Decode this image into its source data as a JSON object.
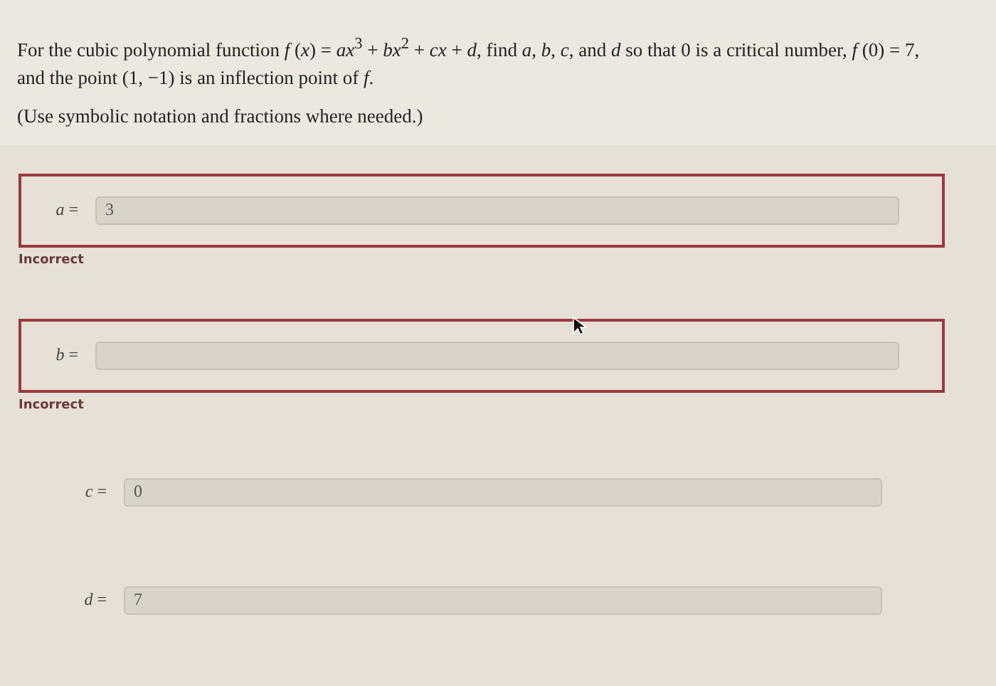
{
  "question": "For the cubic polynomial function *f* (*x*) = *ax*$^{3}$ + *bx*$^{2}$ + *cx* + *d*, find *a*, *b*, *c*, and *d* so that 0 is a critical number, *f* (0) = 7, and the point (1, −1) is an inflection point of *f*.",
  "hint": "(Use symbolic notation and fractions where needed.)",
  "answers": [
    {
      "label": "*a* =",
      "value": "3",
      "incorrect": true,
      "feedback": "Incorrect"
    },
    {
      "label": "*b* =",
      "incorrect": true,
      "feedback": "Incorrect"
    },
    {
      "label": "*c* =",
      "value": "0",
      "incorrect": false
    },
    {
      "label": "*d* =",
      "value": "7",
      "incorrect": false
    }
  ]
}
